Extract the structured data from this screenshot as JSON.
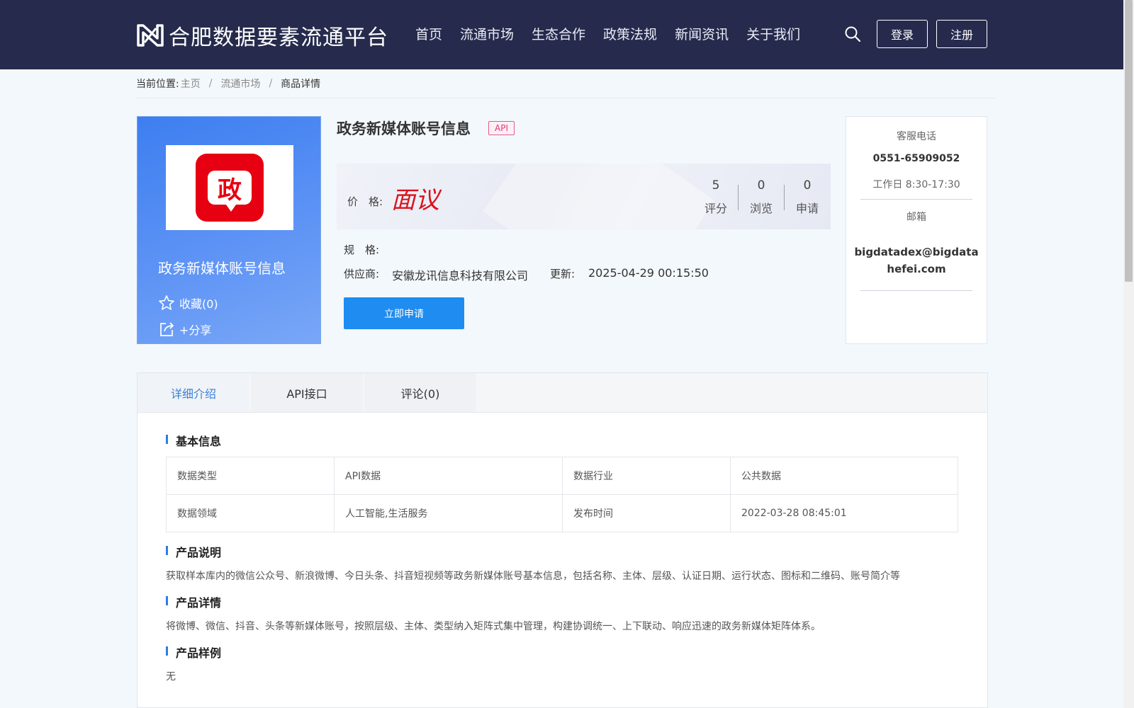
{
  "header": {
    "brand": "合肥数据要素流通平台",
    "nav": [
      "首页",
      "流通市场",
      "生态合作",
      "政策法规",
      "新闻资讯",
      "关于我们"
    ],
    "login": "登录",
    "register": "注册"
  },
  "breadcrumb": {
    "prefix": "当前位置:",
    "items": [
      "主页",
      "流通市场",
      "商品详情"
    ]
  },
  "product": {
    "card_logo_char": "政",
    "card_name": "政务新媒体账号信息",
    "favorite": "收藏(0)",
    "share": "+分享",
    "title": "政务新媒体账号信息",
    "badge": "API",
    "price_label": "价　格:",
    "price": "面议",
    "stats": [
      {
        "num": "5",
        "label": "评分"
      },
      {
        "num": "0",
        "label": "浏览"
      },
      {
        "num": "0",
        "label": "申请"
      }
    ],
    "spec_label": "规　格:",
    "supplier_label": "供应商:",
    "supplier": "安徽龙讯信息科技有限公司",
    "update_label": "更新:",
    "update": "2025-04-29 00:15:50",
    "apply": "立即申请"
  },
  "contact": {
    "phone_label": "客服电话",
    "phone": "0551-65909052",
    "hours": "工作日 8:30-17:30",
    "email_label": "邮箱",
    "email_line1": "bigdatadex@bigdata",
    "email_line2": "hefei.com"
  },
  "tabs": [
    "详细介绍",
    "API接口",
    "评论(0)"
  ],
  "detail": {
    "basic_title": "基本信息",
    "table": [
      [
        "数据类型",
        "API数据",
        "数据行业",
        "公共数据"
      ],
      [
        "数据领域",
        "人工智能,生活服务",
        "发布时间",
        "2022-03-28 08:45:01"
      ]
    ],
    "desc_title": "产品说明",
    "desc": "获取样本库内的微信公众号、新浪微博、今日头条、抖音短视频等政务新媒体账号基本信息，包括名称、主体、层级、认证日期、运行状态、图标和二维码、账号简介等",
    "detail_title": "产品详情",
    "detail_text": "将微博、微信、抖音、头条等新媒体账号，按照层级、主体、类型纳入矩阵式集中管理，构建协调统一、上下联动、响应迅速的政务新媒体矩阵体系。",
    "sample_title": "产品样例",
    "sample_text": "无"
  },
  "colors": {
    "header_bg": "#262b4d",
    "accent": "#1e8cf0",
    "price": "#d9121c",
    "card_blue": "#3d7ef0"
  }
}
